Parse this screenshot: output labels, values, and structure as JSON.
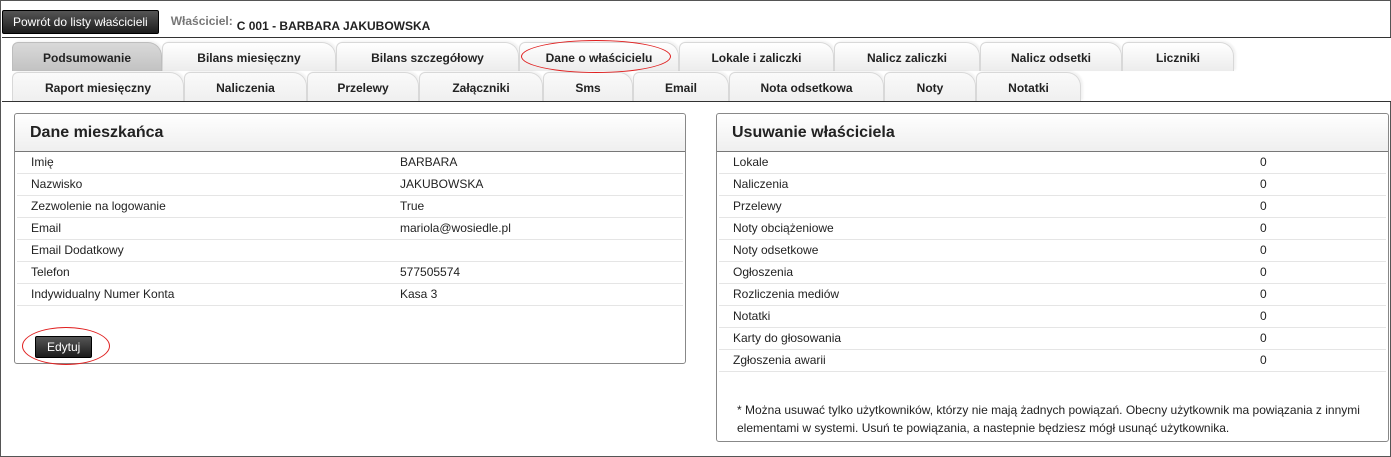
{
  "header": {
    "back_button": "Powrót do listy właścicieli",
    "owner_label": "Właściciel:",
    "owner_value": "C 001 - BARBARA JAKUBOWSKA"
  },
  "tabs": {
    "row1": [
      {
        "label": "Podsumowanie",
        "active": true
      },
      {
        "label": "Bilans miesięczny"
      },
      {
        "label": "Bilans szczegółowy"
      },
      {
        "label": "Dane o właścicielu"
      },
      {
        "label": "Lokale i zaliczki"
      },
      {
        "label": "Nalicz zaliczki"
      },
      {
        "label": "Nalicz odsetki"
      },
      {
        "label": "Liczniki"
      }
    ],
    "row2": [
      {
        "label": "Raport miesięczny"
      },
      {
        "label": "Naliczenia"
      },
      {
        "label": "Przelewy"
      },
      {
        "label": "Załączniki"
      },
      {
        "label": "Sms"
      },
      {
        "label": "Email"
      },
      {
        "label": "Nota odsetkowa"
      },
      {
        "label": "Noty"
      },
      {
        "label": "Notatki"
      }
    ]
  },
  "resident": {
    "title": "Dane mieszkańca",
    "rows": [
      {
        "key": "Imię",
        "value": "BARBARA"
      },
      {
        "key": "Nazwisko",
        "value": "JAKUBOWSKA"
      },
      {
        "key": "Zezwolenie na logowanie",
        "value": "True"
      },
      {
        "key": "Email",
        "value": "mariola@wosiedle.pl"
      },
      {
        "key": "Email Dodatkowy",
        "value": ""
      },
      {
        "key": "Telefon",
        "value": "577505574"
      },
      {
        "key": "Indywidualny Numer Konta",
        "value": "Kasa 3"
      }
    ],
    "edit_button": "Edytuj"
  },
  "removal": {
    "title": "Usuwanie właściciela",
    "rows": [
      {
        "key": "Lokale",
        "value": "0"
      },
      {
        "key": "Naliczenia",
        "value": "0"
      },
      {
        "key": "Przelewy",
        "value": "0"
      },
      {
        "key": "Noty obciążeniowe",
        "value": "0"
      },
      {
        "key": "Noty odsetkowe",
        "value": "0"
      },
      {
        "key": "Ogłoszenia",
        "value": "0"
      },
      {
        "key": "Rozliczenia mediów",
        "value": "0"
      },
      {
        "key": "Notatki",
        "value": "0"
      },
      {
        "key": "Karty do głosowania",
        "value": "0"
      },
      {
        "key": "Zgłoszenia awarii",
        "value": "0"
      }
    ],
    "note": "* Można usuwać tylko użytkowników, którzy nie mają żadnych powiązań. Obecny użytkownik ma powiązania z innymi elementami w systemi. Usuń te powiązania, a nastepnie będziesz mógł usunąć użytkownika."
  },
  "colors": {
    "highlight_ellipse": "#e02020",
    "button_dark": "#1c1c1c",
    "active_tab": "#c8c8c8"
  }
}
